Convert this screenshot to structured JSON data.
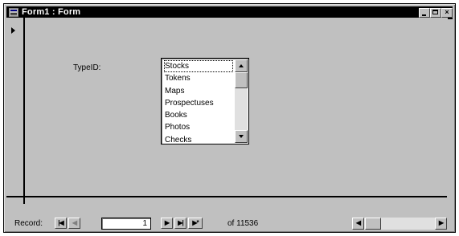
{
  "window": {
    "title": "Form1 : Form"
  },
  "form": {
    "field_label": "TypeID:",
    "list_items": [
      "Stocks",
      "Tokens",
      "Maps",
      "Prospectuses",
      "Books",
      "Photos",
      "Checks"
    ],
    "selected_index": 0
  },
  "navigation": {
    "record_label": "Record:",
    "current_record": "1",
    "of_text": "of  11536"
  },
  "icons": [
    "form-icon",
    "minimize-icon",
    "maximize-icon",
    "close-icon",
    "record-selector-arrow-icon",
    "scroll-up-icon",
    "scroll-down-icon",
    "first-record-icon",
    "previous-record-icon",
    "next-record-icon",
    "last-record-icon",
    "new-record-icon",
    "scroll-left-icon",
    "scroll-right-icon"
  ]
}
